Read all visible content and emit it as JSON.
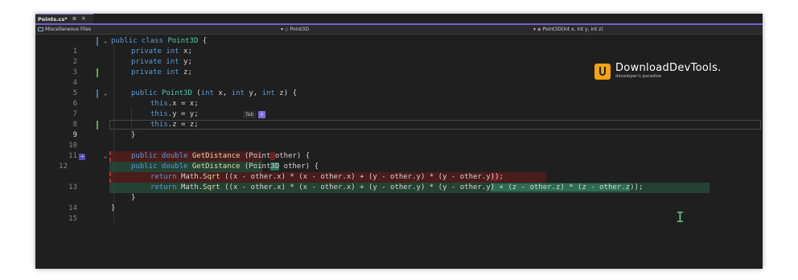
{
  "tab": {
    "label": "Points.cs*",
    "pin_icon": "pin-icon",
    "close_icon": "close-icon"
  },
  "navbar": {
    "project": "Miscellaneous Files",
    "type_member": "Point3D",
    "member": "Point3D(int x, int y, int z)"
  },
  "lines": [
    {
      "n": "1",
      "text": "public class Point3D {"
    },
    {
      "n": "2",
      "text": "private int x;"
    },
    {
      "n": "3",
      "text": "private int y;"
    },
    {
      "n": "4",
      "text": "private int z;"
    },
    {
      "n": "5",
      "text": ""
    },
    {
      "n": "6",
      "text": "public Point3D (int x, int y, int z) {"
    },
    {
      "n": "7",
      "text": "this.x = x;"
    },
    {
      "n": "8",
      "text": "this.y = y;"
    },
    {
      "n": "9",
      "text": "this.z = z;"
    },
    {
      "n": "10",
      "text": "}"
    },
    {
      "n": "11",
      "text": ""
    },
    {
      "n": "12",
      "text": "public double GetDistance (Point other) {"
    },
    {
      "n": "",
      "text": "public double GetDistance (Point3D other) {"
    },
    {
      "n": "13",
      "text": "return Math.Sqrt ((x - other.x) * (x - other.x) + (y - other.y) * (y - other.y));"
    },
    {
      "n": "",
      "text": "return Math.Sqrt ((x - other.x) * (x - other.x) + (y - other.y) * (y - other.y) + (z - other.z) * (z - other.z));"
    },
    {
      "n": "14",
      "text": "}"
    },
    {
      "n": "15",
      "text": "}"
    }
  ],
  "intellicode": {
    "label": "Tab",
    "button": "⇩"
  },
  "watermark": {
    "title": "DownloadDevTools.",
    "subtitle": "developer's paradise"
  },
  "colors": {
    "accent": "#7b5cd6",
    "keyword": "#569cd6",
    "type": "#4ec9b0",
    "method": "#dcdcaa",
    "deleted": "#6e2020",
    "added": "#2e6b55"
  }
}
